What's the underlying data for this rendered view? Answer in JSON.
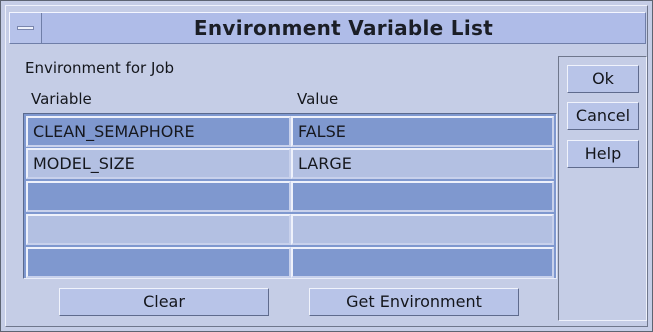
{
  "window": {
    "title": "Environment Variable List"
  },
  "labels": {
    "section": "Environment for Job"
  },
  "table": {
    "columns": [
      "Variable",
      "Value"
    ],
    "rows": [
      {
        "variable": "CLEAN_SEMAPHORE",
        "value": "FALSE"
      },
      {
        "variable": "MODEL_SIZE",
        "value": "LARGE"
      },
      {
        "variable": "",
        "value": ""
      },
      {
        "variable": "",
        "value": ""
      },
      {
        "variable": "",
        "value": ""
      }
    ]
  },
  "buttons": {
    "ok": "Ok",
    "cancel": "Cancel",
    "help": "Help",
    "clear": "Clear",
    "get_environment": "Get Environment"
  }
}
